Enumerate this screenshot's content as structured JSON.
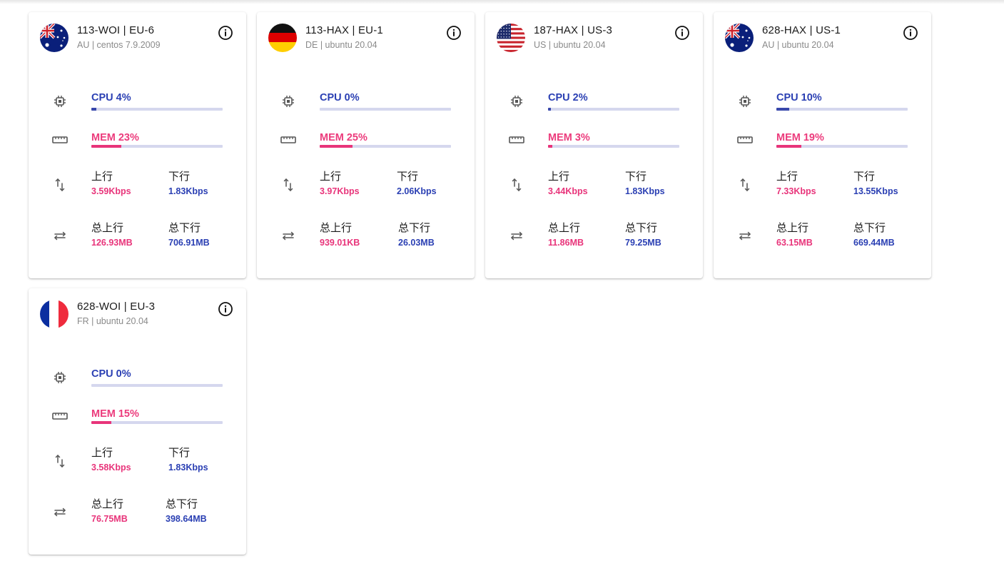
{
  "colors": {
    "cpu": "#3948ab",
    "mem": "#e8347a",
    "track": "#d5d7ee",
    "text_pink": "#e8347a",
    "text_blue": "#2a3fb3"
  },
  "icons": {
    "cpu": "cpu-chip-icon",
    "mem": "memory-icon",
    "net": "up-down-arrows-icon",
    "total": "swap-arrows-icon",
    "info": "info-icon"
  },
  "labels": {
    "up": "上行",
    "down": "下行",
    "total_up": "总上行",
    "total_down": "总下行"
  },
  "servers": [
    {
      "flag": "au",
      "title": "113-WOI | EU-6",
      "subtitle": "AU | centos 7.9.2009",
      "cpu_text": "CPU 4%",
      "cpu_value": 4,
      "mem_text": "MEM 23%",
      "mem_value": 23,
      "up": "3.59Kbps",
      "down": "1.83Kbps",
      "total_up": "126.93MB",
      "total_down": "706.91MB"
    },
    {
      "flag": "de",
      "title": "113-HAX | EU-1",
      "subtitle": "DE | ubuntu 20.04",
      "cpu_text": "CPU 0%",
      "cpu_value": 0,
      "mem_text": "MEM 25%",
      "mem_value": 25,
      "up": "3.97Kbps",
      "down": "2.06Kbps",
      "total_up": "939.01KB",
      "total_down": "26.03MB"
    },
    {
      "flag": "us",
      "title": "187-HAX | US-3",
      "subtitle": "US | ubuntu 20.04",
      "cpu_text": "CPU 2%",
      "cpu_value": 2,
      "mem_text": "MEM 3%",
      "mem_value": 3,
      "up": "3.44Kbps",
      "down": "1.83Kbps",
      "total_up": "11.86MB",
      "total_down": "79.25MB"
    },
    {
      "flag": "au",
      "title": "628-HAX | US-1",
      "subtitle": "AU | ubuntu 20.04",
      "cpu_text": "CPU 10%",
      "cpu_value": 10,
      "mem_text": "MEM 19%",
      "mem_value": 19,
      "up": "7.33Kbps",
      "down": "13.55Kbps",
      "total_up": "63.15MB",
      "total_down": "669.44MB"
    },
    {
      "flag": "fr",
      "title": "628-WOI | EU-3",
      "subtitle": "FR | ubuntu 20.04",
      "cpu_text": "CPU 0%",
      "cpu_value": 0,
      "mem_text": "MEM 15%",
      "mem_value": 15,
      "up": "3.58Kbps",
      "down": "1.83Kbps",
      "total_up": "76.75MB",
      "total_down": "398.64MB"
    }
  ]
}
